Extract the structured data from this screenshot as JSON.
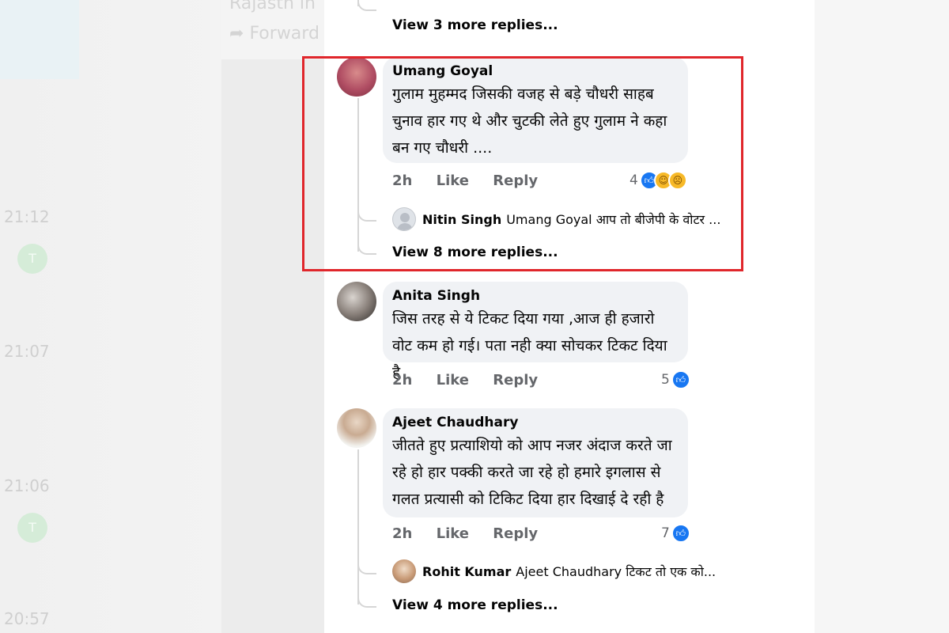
{
  "background": {
    "partial_text_top": "Rajasth in",
    "forward_label": "Forward",
    "times": [
      "21:12",
      "21:07",
      "21:06",
      "20:57"
    ],
    "dot_label": "T"
  },
  "top_thread": {
    "view_more": "View 3 more replies..."
  },
  "comments": [
    {
      "author": "Umang Goyal",
      "text": "गुलाम मुहम्मद जिसकी वजह से बड़े चौधरी साहब चुनाव हार गए थे और चुटकी लेते हुए गुलाम ने कहा बन गए चौधरी ....",
      "time": "2h",
      "like_label": "Like",
      "reply_label": "Reply",
      "reaction_count": "4",
      "reactions": [
        "like",
        "haha",
        "sad"
      ],
      "reply_preview": {
        "author": "Nitin Singh",
        "text": "Umang Goyal आप तो बीजेपी के वोटर ..."
      },
      "view_more": "View 8 more replies..."
    },
    {
      "author": "Anita Singh",
      "text": "जिस तरह से ये टिकट दिया गया ,आज ही हजारो वोट कम हो गई। पता नही क्या सोचकर टिकट दिया है",
      "time": "2h",
      "like_label": "Like",
      "reply_label": "Reply",
      "reaction_count": "5",
      "reactions": [
        "like"
      ]
    },
    {
      "author": "Ajeet Chaudhary",
      "text": "जीतते हुए प्रत्याशियो को आप नजर अंदाज करते जा रहे हो हार पक्की करते जा रहे हो हमारे इगलास से गलत प्रत्यासी को टिकिट दिया हार दिखाई दे रही है",
      "time": "2h",
      "like_label": "Like",
      "reply_label": "Reply",
      "reaction_count": "7",
      "reactions": [
        "like"
      ],
      "reply_preview": {
        "author": "Rohit Kumar",
        "text": "Ajeet Chaudhary टिकट तो एक को..."
      },
      "view_more": "View 4 more replies..."
    }
  ],
  "icons": {
    "like": "thumbs-up-icon",
    "haha": "laughing-face-icon",
    "sad": "sad-face-icon",
    "forward": "forward-arrow-icon"
  },
  "colors": {
    "highlight": "#e0262b",
    "like_blue": "#1877f2",
    "bubble": "#f0f2f5",
    "meta_grey": "#65676b"
  }
}
